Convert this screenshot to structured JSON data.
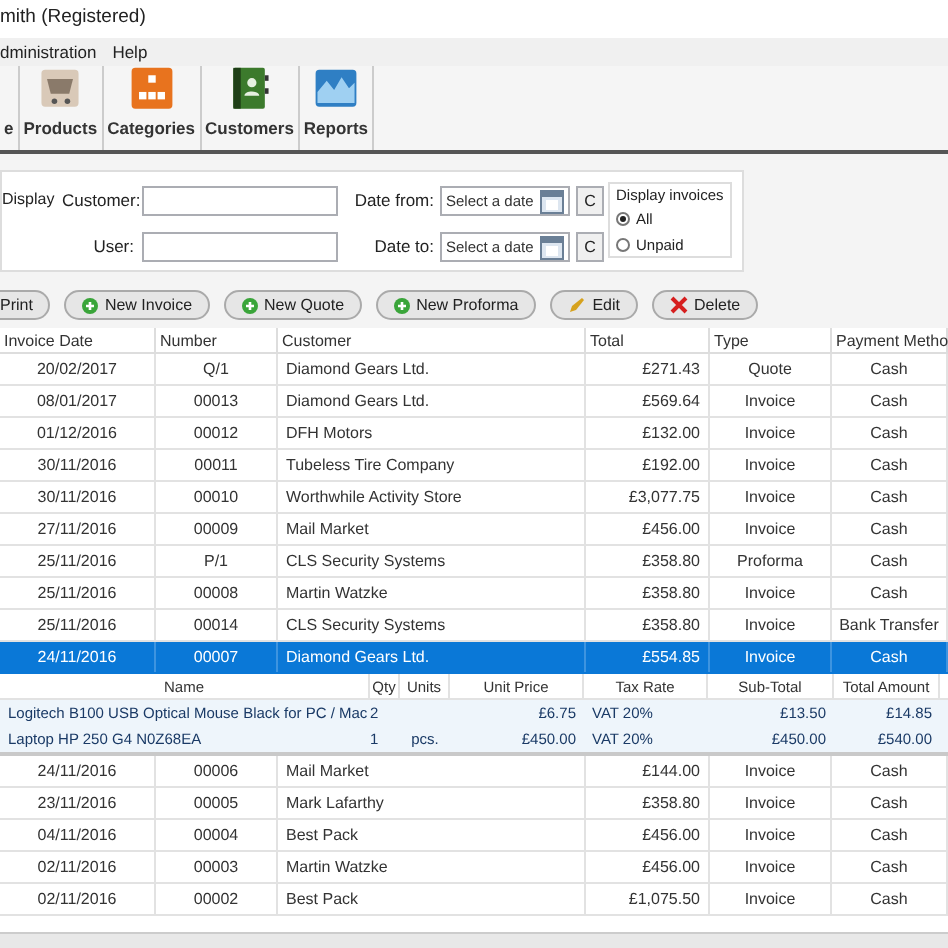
{
  "window": {
    "title": "mith (Registered)"
  },
  "menu": [
    "dministration",
    "Help"
  ],
  "toolbar": [
    {
      "label": "e",
      "kind": "plain"
    },
    {
      "label": "Products",
      "kind": "cart"
    },
    {
      "label": "Categories",
      "kind": "categories"
    },
    {
      "label": "Customers",
      "kind": "book"
    },
    {
      "label": "Reports",
      "kind": "chart"
    }
  ],
  "filters": {
    "title": "Display",
    "customer_label": "Customer:",
    "user_label": "User:",
    "date_from_label": "Date from:",
    "date_to_label": "Date to:",
    "date_from": {
      "placeholder": "Select a date",
      "clear": "C"
    },
    "date_to": {
      "placeholder": "Select a date",
      "clear": "C"
    },
    "display_invoices": {
      "title": "Display invoices",
      "options": [
        {
          "label": "All",
          "selected": true
        },
        {
          "label": "Unpaid",
          "selected": false
        }
      ]
    }
  },
  "actions": [
    {
      "label": "Print",
      "kind": "plain"
    },
    {
      "label": "New Invoice",
      "kind": "new"
    },
    {
      "label": "New Quote",
      "kind": "new"
    },
    {
      "label": "New Proforma",
      "kind": "new"
    },
    {
      "label": "Edit",
      "kind": "edit"
    },
    {
      "label": "Delete",
      "kind": "delete"
    }
  ],
  "table": {
    "columns": [
      "Invoice Date",
      "Number",
      "Customer",
      "Total",
      "Type",
      "Payment Metho"
    ],
    "rows": [
      {
        "cells": [
          "20/02/2017",
          "Q/1",
          "Diamond Gears Ltd.",
          "£271.43",
          "Quote",
          "Cash"
        ],
        "selected": false
      },
      {
        "cells": [
          "08/01/2017",
          "00013",
          "Diamond Gears Ltd.",
          "£569.64",
          "Invoice",
          "Cash"
        ],
        "selected": false
      },
      {
        "cells": [
          "01/12/2016",
          "00012",
          "DFH Motors",
          "£132.00",
          "Invoice",
          "Cash"
        ],
        "selected": false
      },
      {
        "cells": [
          "30/11/2016",
          "00011",
          "Tubeless Tire Company",
          "£192.00",
          "Invoice",
          "Cash"
        ],
        "selected": false
      },
      {
        "cells": [
          "30/11/2016",
          "00010",
          "Worthwhile Activity Store",
          "£3,077.75",
          "Invoice",
          "Cash"
        ],
        "selected": false
      },
      {
        "cells": [
          "27/11/2016",
          "00009",
          "Mail Market",
          "£456.00",
          "Invoice",
          "Cash"
        ],
        "selected": false
      },
      {
        "cells": [
          "25/11/2016",
          "P/1",
          "CLS Security Systems",
          "£358.80",
          "Proforma",
          "Cash"
        ],
        "selected": false
      },
      {
        "cells": [
          "25/11/2016",
          "00008",
          "Martin Watzke",
          "£358.80",
          "Invoice",
          "Cash"
        ],
        "selected": false
      },
      {
        "cells": [
          "25/11/2016",
          "00014",
          "CLS Security Systems",
          "£358.80",
          "Invoice",
          "Bank Transfer"
        ],
        "selected": false
      },
      {
        "cells": [
          "24/11/2016",
          "00007",
          "Diamond Gears Ltd.",
          "£554.85",
          "Invoice",
          "Cash"
        ],
        "selected": true,
        "details": {
          "columns": [
            "Name",
            "Qty",
            "Units",
            "Unit Price",
            "Tax Rate",
            "Sub-Total",
            "Total Amount"
          ],
          "items": [
            {
              "name": "Logitech B100 USB Optical Mouse Black for PC / Mac",
              "qty": "2",
              "unit_price": "£6.75",
              "tax_rate": "VAT 20%",
              "sub_total": "£13.50",
              "total_amount": "£14.85"
            },
            {
              "name": "Laptop HP 250 G4 N0Z68EA",
              "qty": "1",
              "units": "pcs.",
              "unit_price": "£450.00",
              "tax_rate": "VAT 20%",
              "sub_total": "£450.00",
              "total_amount": "£540.00"
            }
          ]
        }
      },
      {
        "cells": [
          "24/11/2016",
          "00006",
          "Mail Market",
          "£144.00",
          "Invoice",
          "Cash"
        ],
        "selected": false
      },
      {
        "cells": [
          "23/11/2016",
          "00005",
          "Mark Lafarthy",
          "£358.80",
          "Invoice",
          "Cash"
        ],
        "selected": false
      },
      {
        "cells": [
          "04/11/2016",
          "00004",
          "Best Pack",
          "£456.00",
          "Invoice",
          "Cash"
        ],
        "selected": false
      },
      {
        "cells": [
          "02/11/2016",
          "00003",
          "Martin Watzke",
          "£456.00",
          "Invoice",
          "Cash"
        ],
        "selected": false
      },
      {
        "cells": [
          "02/11/2016",
          "00002",
          "Best Pack",
          "£1,075.50",
          "Invoice",
          "Cash"
        ],
        "selected": false
      }
    ]
  }
}
